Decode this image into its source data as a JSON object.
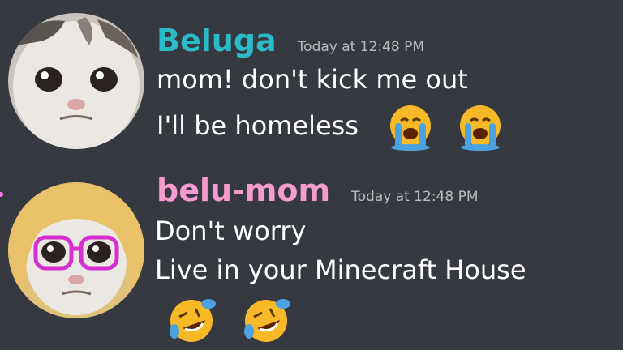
{
  "messages": [
    {
      "username": "Beluga",
      "username_color": "#2bbbc8",
      "timestamp": "Today at 12:48 PM",
      "lines": [
        "mom! don't kick me out",
        "I'll be homeless"
      ],
      "emoji": [
        "loudly-crying-face",
        "loudly-crying-face"
      ]
    },
    {
      "username": "belu-mom",
      "username_color": "#f49bd0",
      "timestamp": "Today at 12:48 PM",
      "lines": [
        "Don't worry",
        "Live in your Minecraft House"
      ],
      "emoji": [
        "rolling-on-floor-laughing-face",
        "rolling-on-floor-laughing-face"
      ]
    }
  ],
  "colors": {
    "background": "#36393f",
    "message_text": "#ffffff",
    "timestamp": "#b9bbbe"
  }
}
